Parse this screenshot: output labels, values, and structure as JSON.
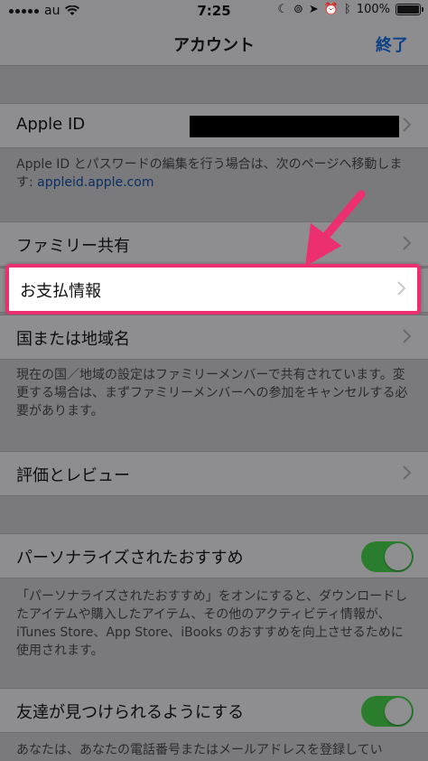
{
  "status_bar": {
    "carrier": "au",
    "time": "7:25",
    "battery": "100%"
  },
  "nav": {
    "title": "アカウント",
    "done": "終了"
  },
  "apple_id": {
    "label": "Apple ID",
    "footer_text": "Apple ID とパスワードの編集を行う場合は、次のページへ移動します: ",
    "footer_link": "appleid.apple.com"
  },
  "rows": {
    "family": "ファミリー共有",
    "payment": "お支払情報",
    "country": "国または地域名",
    "country_footer": "現在の国／地域の設定はファミリーメンバーで共有されています。変更する場合は、まずファミリーメンバーへの参加をキャンセルする必要があります。",
    "ratings": "評価とレビュー",
    "personalized": "パーソナライズされたおすすめ",
    "personalized_footer": "「パーソナライズされたおすすめ」をオンにすると、ダウンロードしたアイテムや購入したアイテム、その他のアクティビティ情報が、iTunes Store、App Store、iBooks のおすすめを向上させるために使用されます。",
    "discoverable": "友達が見つけられるようにする",
    "discoverable_footer": "あなたは、あなたの電話番号またはメールアドレスを登録してい"
  },
  "toggles": {
    "personalized": true,
    "discoverable": true
  },
  "colors": {
    "highlight_border": "#ec2f6f",
    "arrow": "#ec2f6f",
    "toggle_on": "#2b7d2e",
    "link": "#0a2f63"
  }
}
